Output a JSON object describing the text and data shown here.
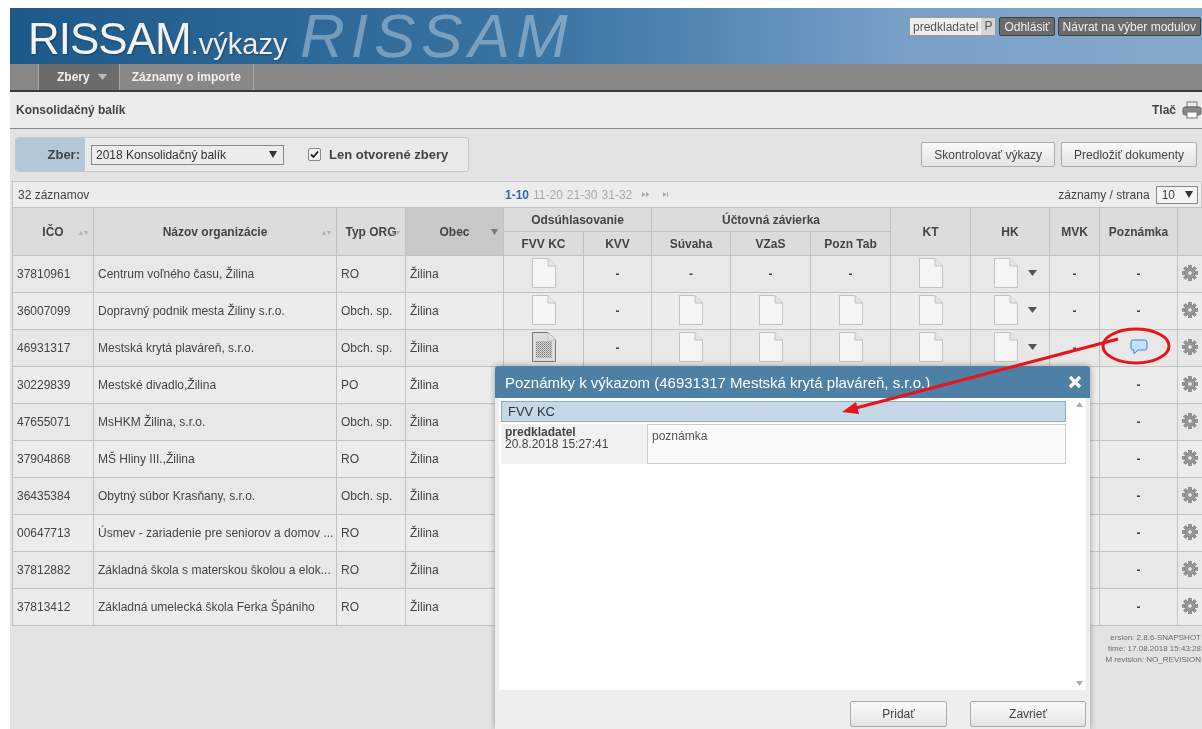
{
  "header": {
    "logo_main": "RISSAM",
    "logo_suffix": ".výkazy",
    "background_text": "RISSAM",
    "user": {
      "name": "predkladatel",
      "role": "P"
    },
    "buttons": [
      "Odhlásiť",
      "Návrat na výber modulov"
    ]
  },
  "nav": {
    "tabs": [
      {
        "label": "Zbery",
        "selected": true,
        "has_menu": true
      },
      {
        "label": "Záznamy o importe",
        "selected": false,
        "has_menu": false
      }
    ]
  },
  "breadcrumb": {
    "title": "Konsolidačný balík",
    "print_label": "Tlač"
  },
  "filter": {
    "label": "Zber:",
    "selected_value": "2018 Konsolidačný balík",
    "open_only": {
      "label": "Len otvorené zbery",
      "checked": true
    }
  },
  "actions": [
    "Skontrolovať výkazy",
    "Predložiť dokumenty"
  ],
  "table_toolbar": {
    "count": "32 záznamov",
    "pages": [
      {
        "label": "1-10",
        "selected": true
      },
      {
        "label": "11-20",
        "selected": false
      },
      {
        "label": "21-30",
        "selected": false
      },
      {
        "label": "31-32",
        "selected": false
      }
    ],
    "per_page_label": "záznamy / strana",
    "per_page": "10"
  },
  "table": {
    "columns": [
      {
        "label": "IČO",
        "kind": "sort"
      },
      {
        "label": "Názov organizácie",
        "kind": "sort"
      },
      {
        "label": "Typ ORG",
        "kind": "sort"
      },
      {
        "label": "Obec",
        "kind": "filter"
      },
      {
        "label": "Odsúhlasovanie",
        "kind": "group",
        "children": [
          {
            "label": "FVV KC"
          },
          {
            "label": "KVV"
          }
        ]
      },
      {
        "label": "Účtovná závierka",
        "kind": "group",
        "children": [
          {
            "label": "Súvaha"
          },
          {
            "label": "VZaS"
          },
          {
            "label": "Pozn Tab"
          }
        ]
      },
      {
        "label": "KT",
        "kind": "plain"
      },
      {
        "label": "HK",
        "kind": "plain"
      },
      {
        "label": "MVK",
        "kind": "plain"
      },
      {
        "label": "Poznámka",
        "kind": "plain"
      }
    ],
    "rows": [
      {
        "ico": "37810961",
        "name": "Centrum voľného času, Žilina",
        "type": "RO",
        "city": "Žilina",
        "reports": [
          {
            "kind": "doc"
          },
          {
            "kind": "dash",
            "text": "-"
          },
          {
            "kind": "dash",
            "text": "-"
          },
          {
            "kind": "dash",
            "text": "-"
          },
          {
            "kind": "dash",
            "text": "-"
          },
          {
            "kind": "doc"
          },
          {
            "kind": "doc-menu"
          },
          {
            "kind": "dash",
            "text": "-"
          }
        ],
        "note": {
          "kind": "dash",
          "text": "-"
        }
      },
      {
        "ico": "36007099",
        "name": "Dopravný podnik mesta Žiliny s.r.o.",
        "type": "Obch. sp.",
        "city": "Žilina",
        "reports": [
          {
            "kind": "doc"
          },
          {
            "kind": "dash",
            "text": "-"
          },
          {
            "kind": "doc"
          },
          {
            "kind": "doc"
          },
          {
            "kind": "doc"
          },
          {
            "kind": "doc"
          },
          {
            "kind": "doc-menu"
          },
          {
            "kind": "dash",
            "text": "-"
          }
        ],
        "note": {
          "kind": "dash",
          "text": "-"
        }
      },
      {
        "ico": "46931317",
        "name": "Mestská krytá plaváreň, s.r.o.",
        "type": "Obch. sp.",
        "city": "Žilina",
        "reports": [
          {
            "kind": "doc-filled"
          },
          {
            "kind": "dash",
            "text": "-"
          },
          {
            "kind": "doc"
          },
          {
            "kind": "doc"
          },
          {
            "kind": "doc"
          },
          {
            "kind": "doc"
          },
          {
            "kind": "doc-menu"
          },
          {
            "kind": "dash",
            "text": "-"
          }
        ],
        "note": {
          "kind": "comment"
        }
      },
      {
        "ico": "30229839",
        "name": "Mestské divadlo,Žilina",
        "type": "PO",
        "city": "Žilina",
        "note": {
          "kind": "dash",
          "text": "-"
        }
      },
      {
        "ico": "47655071",
        "name": "MsHKM Žilina, s.r.o.",
        "type": "Obch. sp.",
        "city": "Žilina",
        "note": {
          "kind": "dash",
          "text": "-"
        }
      },
      {
        "ico": "37904868",
        "name": "MŠ Hliny III.,Žilina",
        "type": "RO",
        "city": "Žilina",
        "note": {
          "kind": "dash",
          "text": "-"
        }
      },
      {
        "ico": "36435384",
        "name": "Obytný súbor Krasňany, s.r.o.",
        "type": "Obch. sp.",
        "city": "Žilina",
        "note": {
          "kind": "dash",
          "text": "-"
        }
      },
      {
        "ico": "00647713",
        "name": "Úsmev - zariadenie pre seniorov a domov ...",
        "type": "RO",
        "city": "Žilina",
        "note": {
          "kind": "dash",
          "text": "-"
        }
      },
      {
        "ico": "37812882",
        "name": "Základná škola s materskou školou a elok...",
        "type": "RO",
        "city": "Žilina",
        "note": {
          "kind": "dash",
          "text": "-"
        }
      },
      {
        "ico": "37813412",
        "name": "Základná umelecká škola Ferka Špániho",
        "type": "RO",
        "city": "Žilina",
        "note": {
          "kind": "dash",
          "text": "-"
        }
      }
    ]
  },
  "footer": {
    "lines": [
      "ersion: 2.8.6-SNAPSHOT",
      "time: 17.08.2018 15:43:28",
      "M revision: NO_REVISION"
    ]
  },
  "dialog": {
    "title": "Poznámky k výkazom (46931317 Mestská krytá plaváreň, s.r.o.)",
    "sections": [
      {
        "title": "FVV KC",
        "notes": [
          {
            "author": "predkladatel",
            "time": "20.8.2018 15:27:41",
            "text": "poznámka"
          }
        ]
      }
    ],
    "buttons": [
      "Pridať",
      "Zavrieť"
    ]
  }
}
